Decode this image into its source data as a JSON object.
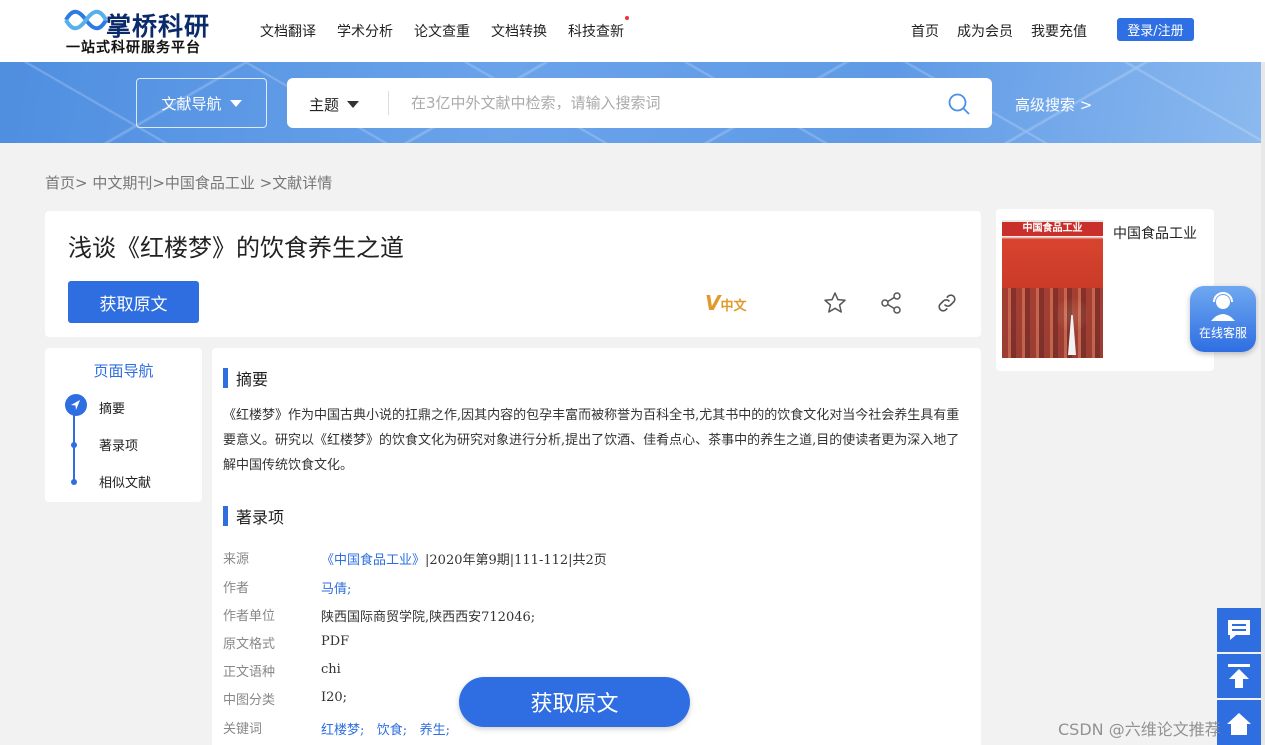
{
  "header": {
    "logo_title": "掌桥科研",
    "logo_sub": "一站式科研服务平台",
    "nav": [
      "文档翻译",
      "学术分析",
      "论文查重",
      "文档转换",
      "科技查新"
    ],
    "right_links": [
      "首页",
      "成为会员",
      "我要充值"
    ],
    "login_label": "登录/注册"
  },
  "search": {
    "doc_nav_label": "文献导航",
    "type_label": "主题",
    "placeholder": "在3亿中外文献中检索，请输入搜索词",
    "advanced_label": "高级搜索 >"
  },
  "breadcrumb": "首页> 中文期刊>中国食品工业 >文献详情",
  "document": {
    "title": "浅谈《红楼梦》的饮食养生之道",
    "get_label": "获取原文",
    "lang_badge": "中文",
    "journal_name": "中国食品工业",
    "cover_masthead": "中国食品工业"
  },
  "page_nav": {
    "title": "页面导航",
    "items": [
      "摘要",
      "著录项",
      "相似文献"
    ]
  },
  "abstract": {
    "heading": "摘要",
    "text": "《红楼梦》作为中国古典小说的扛鼎之作,因其内容的包孕丰富而被称誉为百科全书,尤其书中的的饮食文化对当今社会养生具有重要意义。研究以《红楼梦》的饮食文化为研究对象进行分析,提出了饮酒、佳肴点心、茶事中的养生之道,目的使读者更为深入地了解中国传统饮食文化。"
  },
  "record": {
    "heading": "著录项",
    "source_label": "来源",
    "source_link": "《中国食品工业》",
    "source_rest": "|2020年第9期|111-112|共2页",
    "author_label": "作者",
    "author": "马倩;",
    "affiliation_label": "作者单位",
    "affiliation": "陕西国际商贸学院,陕西西安712046;",
    "format_label": "原文格式",
    "format": "PDF",
    "language_label": "正文语种",
    "language": "chi",
    "clc_label": "中图分类",
    "clc": "I20;",
    "keywords_label": "关键词",
    "keywords": [
      "红楼梦;",
      "饮食;",
      "养生;"
    ]
  },
  "float_button_label": "获取原文",
  "online_service_label": "在线客服",
  "watermark": "CSDN @六维论文推荐",
  "colors": {
    "accent": "#2e6ee0",
    "brand": "#0b2a6b"
  },
  "icons": [
    "search-icon",
    "star-icon",
    "share-icon",
    "link-icon",
    "chat-icon",
    "back-to-top-icon",
    "home-icon",
    "customer-service-icon"
  ]
}
